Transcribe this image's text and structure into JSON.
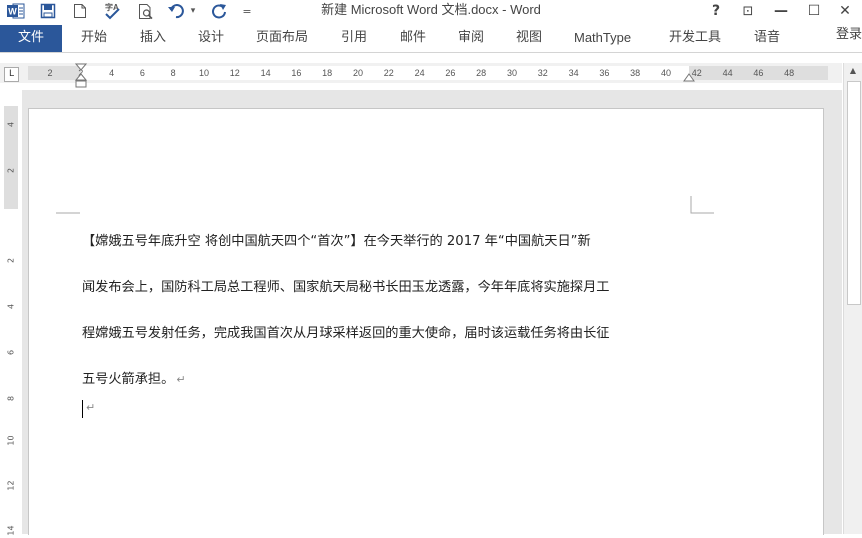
{
  "window": {
    "title": "新建 Microsoft Word 文档.docx - Word",
    "controls": {
      "help": "?",
      "restore_ribbon": "⊡",
      "minimize": "—",
      "maximize": "☐",
      "close": "✕"
    },
    "sign_in": "登录"
  },
  "quick_access": {
    "icons": [
      "word-logo-icon",
      "save-icon",
      "new-document-icon",
      "spelling-icon",
      "print-preview-icon",
      "undo-icon",
      "redo-icon",
      "customize-toolbar-icon"
    ],
    "undo_arrow": "▾",
    "customize_glyph": "="
  },
  "ribbon": {
    "tabs": [
      "文件",
      "开始",
      "插入",
      "设计",
      "页面布局",
      "引用",
      "邮件",
      "审阅",
      "视图",
      "MathType",
      "开发工具",
      "语音"
    ],
    "active": "文件",
    "file_tab_color": "#2b579a"
  },
  "rulers": {
    "tab_selector": "L",
    "horizontal_labels": [
      "2",
      "2",
      "4",
      "6",
      "8",
      "10",
      "12",
      "14",
      "16",
      "18",
      "20",
      "22",
      "24",
      "26",
      "28",
      "30",
      "32",
      "34",
      "36",
      "38",
      "40",
      "42",
      "44",
      "46",
      "48"
    ],
    "vertical_labels": [
      "4",
      "2",
      "2",
      "4",
      "6",
      "8",
      "10",
      "12",
      "14"
    ]
  },
  "document": {
    "paragraph_lines": [
      "【嫦娥五号年底升空 将创中国航天四个“首次”】在今天举行的 2017 年“中国航天日”新",
      "闻发布会上，国防科工局总工程师、国家航天局秘书长田玉龙透露，今年年底将实施探月工",
      "程嫦娥五号发射任务，完成我国首次从月球采样返回的重大使命，届时该运载任务将由长征",
      "五号火箭承担。"
    ],
    "paragraph_mark": "↵",
    "empty_paragraph_mark": "↵"
  },
  "scrollbar": {
    "up_arrow": "▲"
  }
}
